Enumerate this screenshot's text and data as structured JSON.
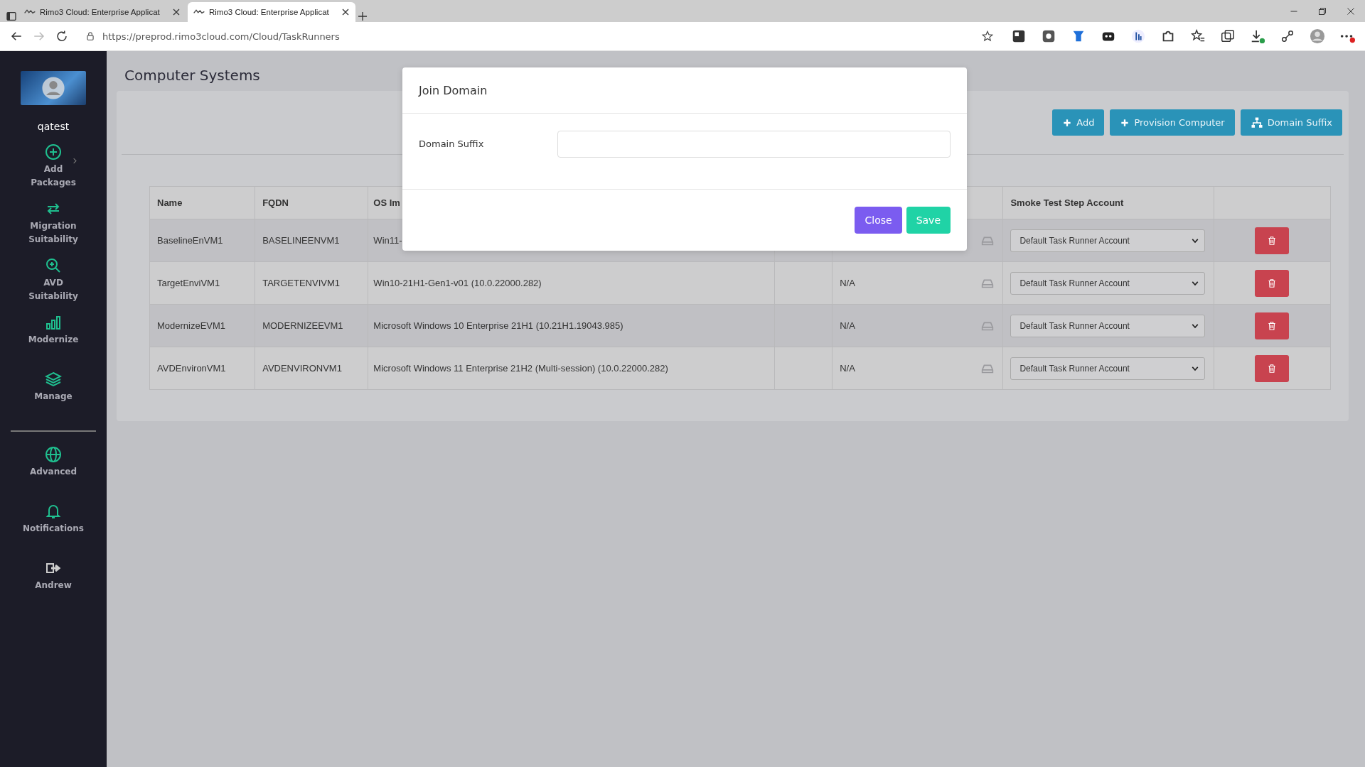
{
  "browser": {
    "tabs": [
      {
        "title": "Rimo3 Cloud: Enterprise Applicat",
        "selected": false
      },
      {
        "title": "Rimo3 Cloud: Enterprise Applicat",
        "selected": true
      }
    ],
    "url": "https://preprod.rimo3cloud.com/Cloud/TaskRunners"
  },
  "sidebar": {
    "user": "qatest",
    "items": [
      {
        "label": "Add Packages",
        "expandable": true
      },
      {
        "label": "Migration Suitability",
        "expandable": false
      },
      {
        "label": "AVD Suitability",
        "expandable": false
      },
      {
        "label": "Modernize",
        "expandable": false
      },
      {
        "label": "Manage",
        "expandable": false
      }
    ],
    "bottom_items": [
      {
        "label": "Advanced"
      },
      {
        "label": "Notifications"
      },
      {
        "label": "Andrew"
      }
    ]
  },
  "page": {
    "title": "Computer Systems",
    "toolbar": [
      "Add",
      "Provision Computer",
      "Domain Suffix"
    ],
    "table": {
      "columns": [
        "Name",
        "FQDN",
        "OS Im",
        "Smoke Test Step Account"
      ],
      "rows": [
        {
          "name": "BaselineEnVM1",
          "fqdn": "BASELINEENVM1",
          "os_image": "Win11-",
          "account": "Default Task Runner Account"
        },
        {
          "name": "TargetEnviVM1",
          "fqdn": "TARGETENVIVM1",
          "os_image": "Win10-21H1-Gen1-v01 (10.0.22000.282)",
          "status": "N/A",
          "account": "Default Task Runner Account"
        },
        {
          "name": "ModernizeEVM1",
          "fqdn": "MODERNIZEEVM1",
          "os_image": "Microsoft Windows 10 Enterprise 21H1 (10.21H1.19043.985)",
          "status": "N/A",
          "account": "Default Task Runner Account"
        },
        {
          "name": "AVDEnvironVM1",
          "fqdn": "AVDENVIRONVM1",
          "os_image": "Microsoft Windows 11 Enterprise 21H2 (Multi-session) (10.0.22000.282)",
          "status": "N/A",
          "account": "Default Task Runner Account"
        }
      ]
    }
  },
  "modal": {
    "title": "Join Domain",
    "field_label": "Domain Suffix",
    "buttons": [
      {
        "label": "Close",
        "kind": "secondary"
      },
      {
        "label": "Save",
        "kind": "primary"
      }
    ]
  }
}
